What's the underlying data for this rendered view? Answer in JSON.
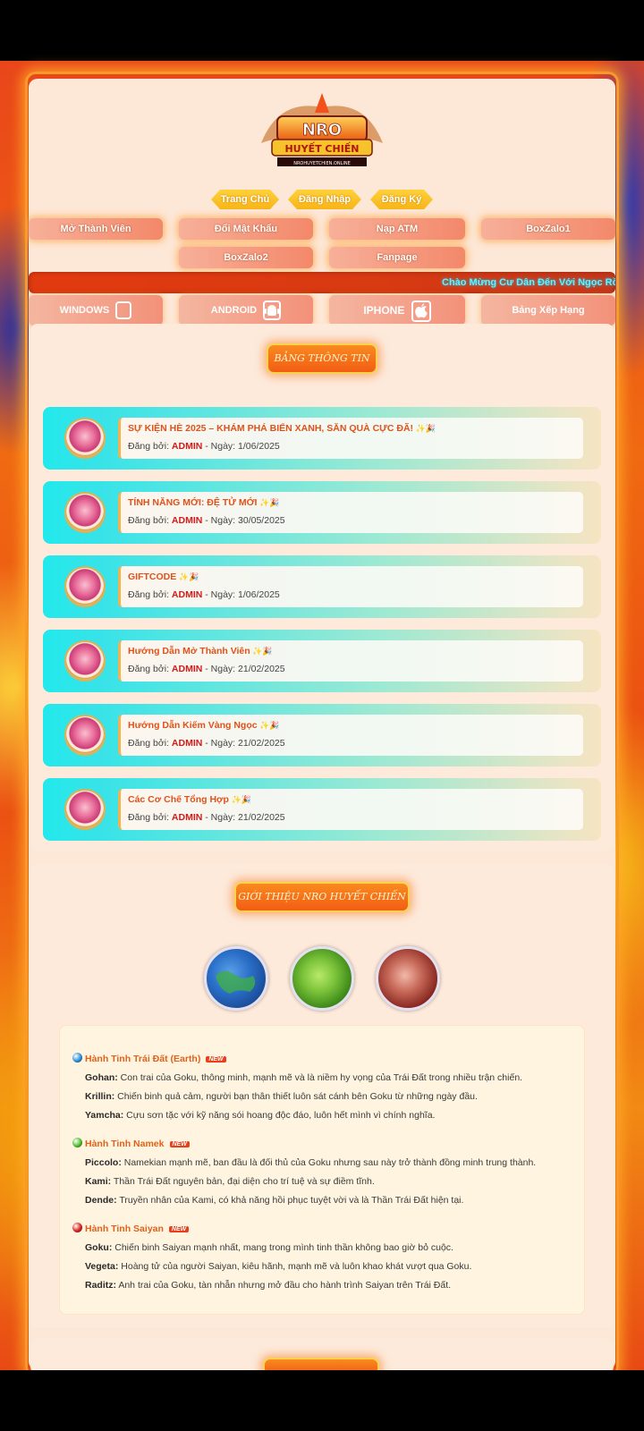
{
  "logo": {
    "alt": "NRO HUYẾT CHIẾN"
  },
  "nav": {
    "home": "Trang Chủ",
    "login": "Đăng Nhập",
    "register": "Đăng Ký"
  },
  "menu": {
    "open_member": "Mở Thành Viên",
    "change_password": "Đổi Mật Khẩu",
    "topup_atm": "Nạp ATM",
    "boxzalo1": "BoxZalo1",
    "boxzalo2": "BoxZalo2",
    "fanpage": "Fanpage"
  },
  "marquee": "Chào Mừng Cư Dân Đến Với Ngọc Rồng Hu",
  "downloads": {
    "windows": "WINDOWS",
    "android": "ANDROID",
    "iphone": "IPHONE",
    "ranking": "Bảng Xếp Hạng"
  },
  "news": {
    "title": "BẢNG THÔNG TIN",
    "posts": [
      {
        "title": "SỰ KIỆN HÈ 2025 – KHÁM PHÁ BIỂN XANH, SĂN QUÀ CỰC ĐÃ!",
        "by_label": "Đăng bởi:",
        "author": "ADMIN",
        "date_label": " - Ngày: ",
        "date": "1/06/2025"
      },
      {
        "title": "TÍNH NĂNG MỚI: ĐỆ TỬ MỚI",
        "by_label": "Đăng bởi:",
        "author": "ADMIN",
        "date_label": " - Ngày: ",
        "date": "30/05/2025"
      },
      {
        "title": "GIFTCODE",
        "by_label": "Đăng bởi:",
        "author": "ADMIN",
        "date_label": " - Ngày: ",
        "date": "1/06/2025"
      },
      {
        "title": "Hướng Dẫn Mở Thành Viên",
        "by_label": "Đăng bởi:",
        "author": "ADMIN",
        "date_label": " - Ngày: ",
        "date": "21/02/2025"
      },
      {
        "title": "Hướng Dẫn Kiếm Vàng Ngọc",
        "by_label": "Đăng bởi:",
        "author": "ADMIN",
        "date_label": " - Ngày: ",
        "date": "21/02/2025"
      },
      {
        "title": "Các Cơ Chế Tổng Hợp",
        "by_label": "Đăng bởi:",
        "author": "ADMIN",
        "date_label": " - Ngày: ",
        "date": "21/02/2025"
      }
    ]
  },
  "intro": {
    "title": "GIỚI THIỆU NRO HUYẾT CHIẾN",
    "sections": [
      {
        "heading": "Hành Tinh Trái Đất (Earth)",
        "color": "#2a8fd8",
        "chars": [
          {
            "name": "Gohan:",
            "desc": " Con trai của Goku, thông minh, mạnh mẽ và là niềm hy vọng của Trái Đất trong nhiều trận chiến."
          },
          {
            "name": "Krillin:",
            "desc": " Chiến binh quả cảm, người bạn thân thiết luôn sát cánh bên Goku từ những ngày đầu."
          },
          {
            "name": "Yamcha:",
            "desc": " Cựu sơn tặc với kỹ năng sói hoang độc đáo, luôn hết mình vì chính nghĩa."
          }
        ]
      },
      {
        "heading": "Hành Tinh Namek",
        "color": "#4cc02a",
        "chars": [
          {
            "name": "Piccolo:",
            "desc": " Namekian mạnh mẽ, ban đầu là đối thủ của Goku nhưng sau này trở thành đồng minh trung thành."
          },
          {
            "name": "Kami:",
            "desc": " Thần Trái Đất nguyên bản, đại diện cho trí tuệ và sự điềm tĩnh."
          },
          {
            "name": "Dende:",
            "desc": " Truyền nhân của Kami, có khả năng hồi phục tuyệt vời và là Thần Trái Đất hiện tại."
          }
        ]
      },
      {
        "heading": "Hành Tinh Saiyan",
        "color": "#d8201a",
        "chars": [
          {
            "name": "Goku:",
            "desc": " Chiến binh Saiyan mạnh nhất, mang trong mình tinh thần không bao giờ bỏ cuộc."
          },
          {
            "name": "Vegeta:",
            "desc": " Hoàng tử của người Saiyan, kiêu hãnh, mạnh mẽ và luôn khao khát vượt qua Goku."
          },
          {
            "name": "Raditz:",
            "desc": " Anh trai của Goku, tàn nhẫn nhưng mở đầu cho hành trình Saiyan trên Trái Đất."
          }
        ]
      }
    ],
    "new_badge": "NEW"
  }
}
